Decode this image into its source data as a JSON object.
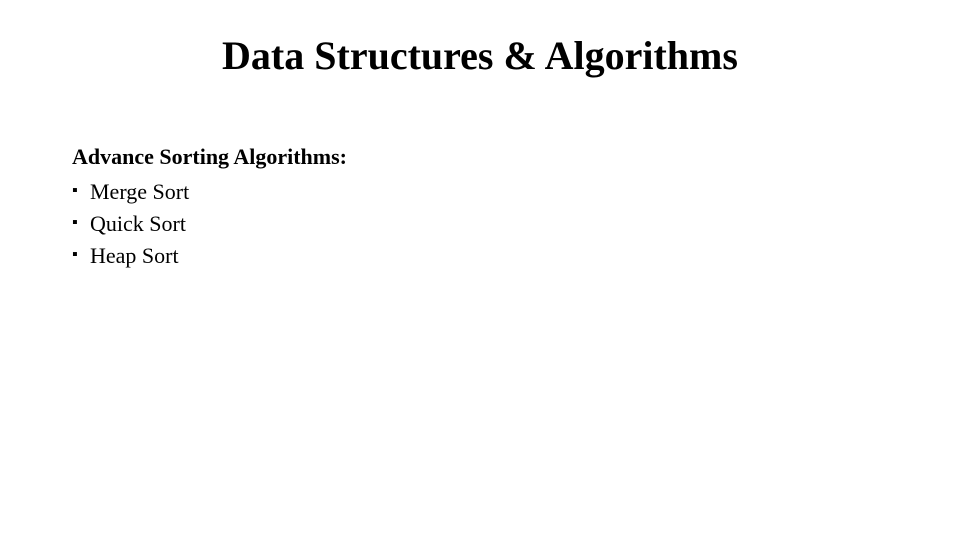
{
  "title": "Data Structures & Algorithms",
  "subheading": "Advance Sorting Algorithms:",
  "bullets": [
    "Merge Sort",
    "Quick Sort",
    "Heap Sort"
  ]
}
